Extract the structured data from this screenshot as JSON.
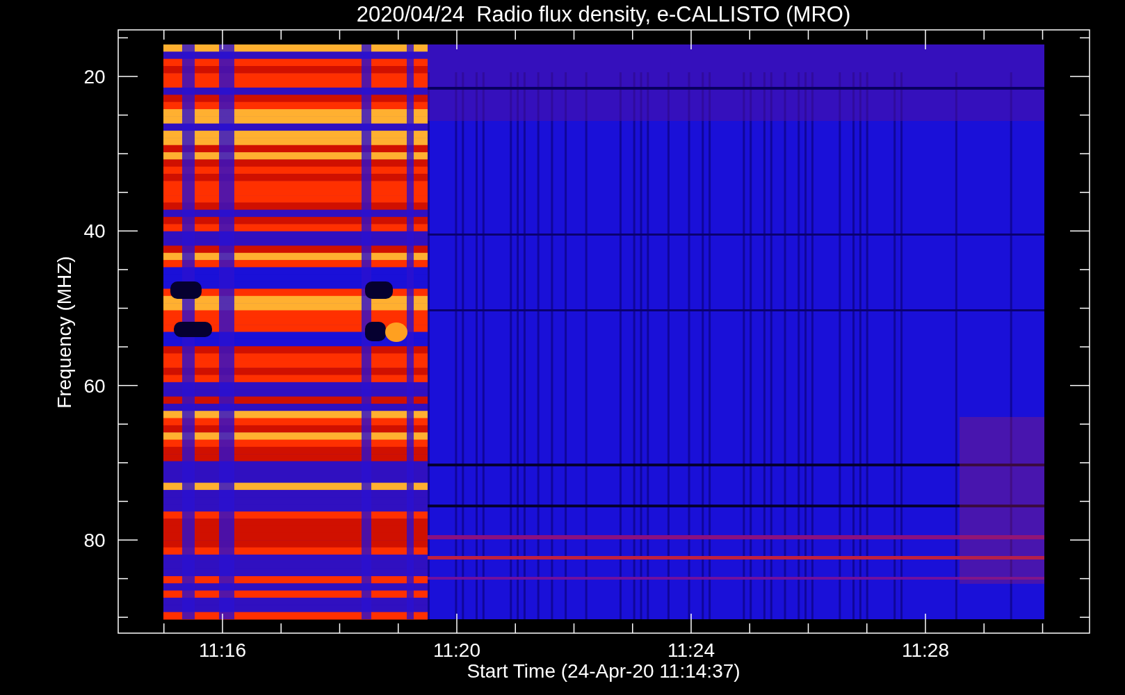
{
  "title": "2020/04/24  Radio flux density, e-CALLISTO (MRO)",
  "y_axis": {
    "label": "Frequency (MHZ)",
    "ticks": [
      "20",
      "40",
      "60",
      "80"
    ]
  },
  "x_axis": {
    "label": "Start Time (24-Apr-20 11:14:37)",
    "ticks": [
      "11:16",
      "11:20",
      "11:24",
      "11:28"
    ]
  }
}
